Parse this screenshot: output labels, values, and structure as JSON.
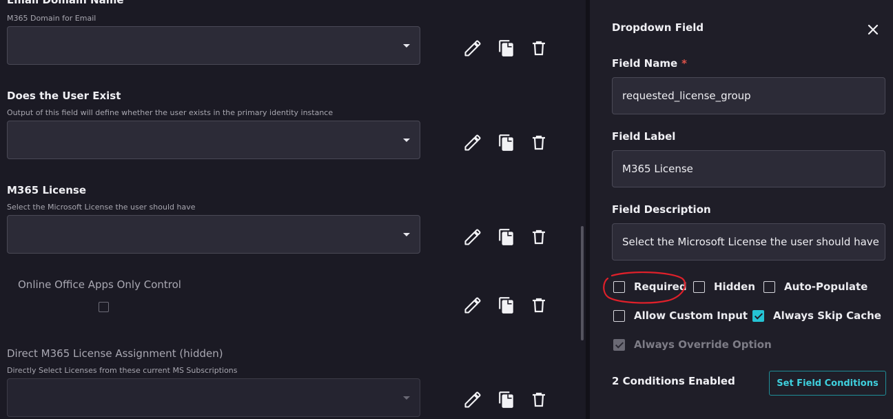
{
  "fields": [
    {
      "title": "Email Domain Name",
      "description": "M365 Domain for Email"
    },
    {
      "title": "Does the User Exist",
      "description": "Output of this field will define whether the user exists in the primary identity instance"
    },
    {
      "title": "M365 License",
      "description": "Select the Microsoft License the user should have"
    },
    {
      "title": "Online Office Apps Only Control",
      "description": ""
    },
    {
      "title": "Direct M365 License Assignment (hidden)",
      "description": "Directly Select Licenses from these current MS Subscriptions"
    }
  ],
  "panel": {
    "title": "Dropdown Field",
    "field_name_label": "Field Name",
    "required_star": "*",
    "field_name_value": "requested_license_group",
    "field_label_label": "Field Label",
    "field_label_value": "M365 License",
    "field_description_label": "Field Description",
    "field_description_value": "Select the Microsoft License the user should have",
    "options": {
      "required": {
        "label": "Required",
        "checked": false
      },
      "hidden": {
        "label": "Hidden",
        "checked": false
      },
      "auto_populate": {
        "label": "Auto-Populate",
        "checked": false
      },
      "allow_custom_input": {
        "label": "Allow Custom Input",
        "checked": false
      },
      "always_skip_cache": {
        "label": "Always Skip Cache",
        "checked": true
      },
      "always_override_option": {
        "label": "Always Override Option",
        "checked": true,
        "disabled": true
      }
    },
    "conditions_text": "2 Conditions Enabled",
    "set_conditions_button": "Set Field Conditions"
  },
  "colors": {
    "accent": "#25c3d4",
    "annotation": "#e0202a",
    "required_star": "#e0534a"
  },
  "icons": [
    "pencil-icon",
    "copy-icon",
    "trash-icon",
    "close-icon",
    "caret-down-icon"
  ]
}
